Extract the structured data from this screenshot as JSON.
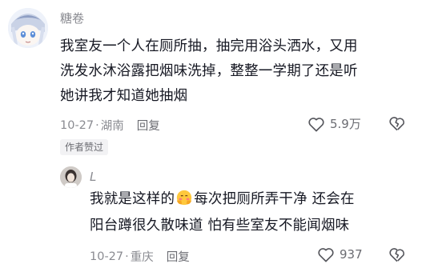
{
  "comments": [
    {
      "username": "糖卷",
      "lines": [
        "我室友一个人在厕所抽，抽完用浴头洒水，又用",
        "洗发水沐浴露把烟味洗掉，整整一学期了还是听",
        "她讲我才知道她抽烟"
      ],
      "date": "10-27",
      "location": "湖南",
      "reply_label": "回复",
      "like_count": "5.9万",
      "badge": "作者赞过"
    },
    {
      "username": "L",
      "line1_before": "我就是这样的",
      "line1_after": "每次把厕所弄干净 还会在",
      "line2": "阳台蹲很久散味道 怕有些室友不能闻烟味",
      "date": "10-27",
      "location": "重庆",
      "reply_label": "回复",
      "like_count": "937"
    }
  ],
  "icons": {
    "like": "heart-outline-icon",
    "dislike": "broken-heart-icon",
    "emoji": "blushing-hands-face-emoji"
  },
  "colors": {
    "text": "#161823",
    "muted": "#8a8b91",
    "badge_bg": "#f2f2f4"
  }
}
